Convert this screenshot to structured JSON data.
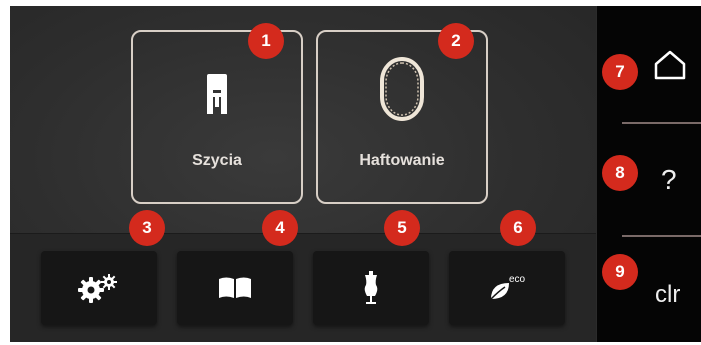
{
  "tiles": {
    "sewing_label": "Szycia",
    "embroidery_label": "Haftowanie"
  },
  "badges": [
    "1",
    "2",
    "3",
    "4",
    "5",
    "6",
    "7",
    "8",
    "9"
  ],
  "sidebar": {
    "help_label": "?",
    "clear_label": "clr"
  },
  "icons": {
    "sewing": "presser-foot-icon",
    "embroidery": "embroidery-hoop-icon",
    "settings": "gears-icon",
    "guide": "book-icon",
    "tutorial": "dress-form-icon",
    "eco": "eco-leaf-icon",
    "home": "home-icon"
  },
  "eco_text": "eco",
  "colors": {
    "badge": "#d42a1d",
    "tile_border": "#d8cfc6",
    "separator": "#7a6a68"
  }
}
